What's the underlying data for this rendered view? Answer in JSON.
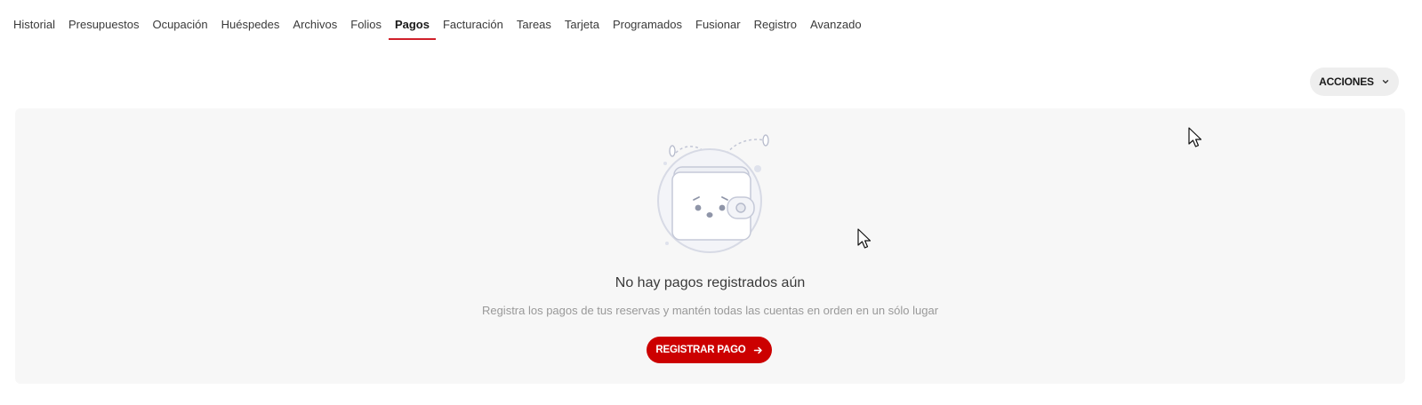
{
  "tabs": [
    {
      "label": "Historial",
      "active": false
    },
    {
      "label": "Presupuestos",
      "active": false
    },
    {
      "label": "Ocupación",
      "active": false
    },
    {
      "label": "Huéspedes",
      "active": false
    },
    {
      "label": "Archivos",
      "active": false
    },
    {
      "label": "Folios",
      "active": false
    },
    {
      "label": "Pagos",
      "active": true
    },
    {
      "label": "Facturación",
      "active": false
    },
    {
      "label": "Tareas",
      "active": false
    },
    {
      "label": "Tarjeta",
      "active": false
    },
    {
      "label": "Programados",
      "active": false
    },
    {
      "label": "Fusionar",
      "active": false
    },
    {
      "label": "Registro",
      "active": false
    },
    {
      "label": "Avanzado",
      "active": false
    }
  ],
  "toolbar": {
    "actions_label": "ACCIONES",
    "actions_icon": "chevron-down-icon"
  },
  "empty_state": {
    "illustration": "sad-wallet-illustration",
    "title": "No hay pagos registrados aún",
    "subtitle": "Registra los pagos de tus reservas y mantén todas las cuentas en orden en un sólo lugar",
    "button_label": "REGISTRAR PAGO",
    "button_icon": "arrow-right-icon"
  },
  "colors": {
    "accent": "#cc0000",
    "active_tab_underline": "#d0202a",
    "panel_bg": "#f7f7f7",
    "button_bg": "#eeeeee"
  }
}
